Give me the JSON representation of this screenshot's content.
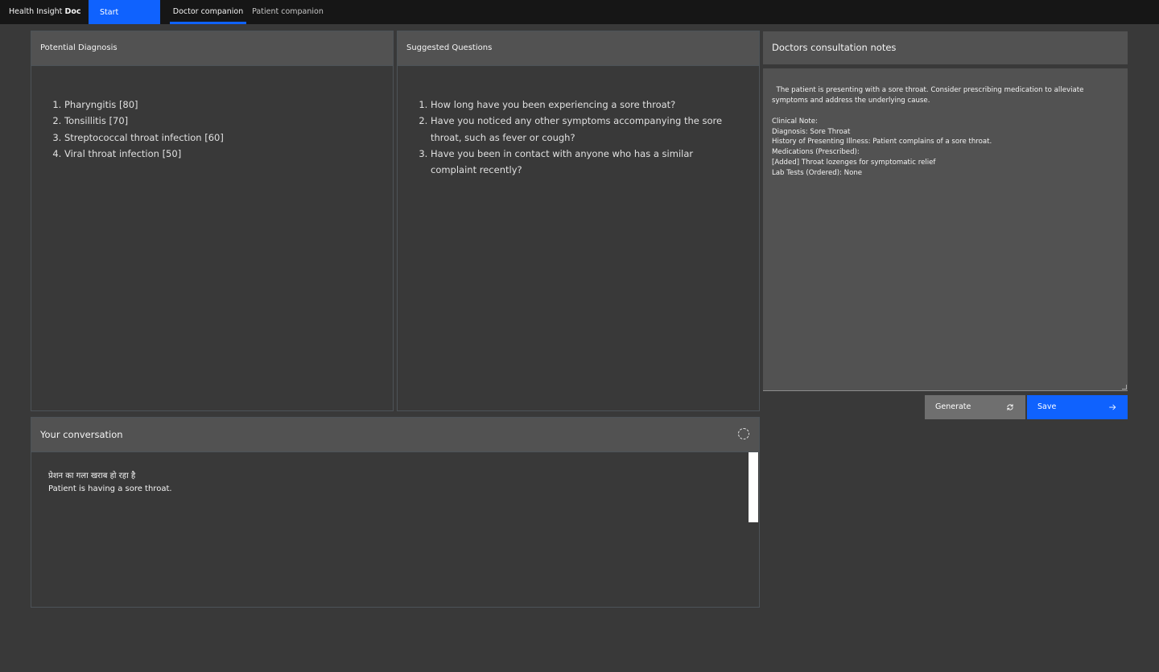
{
  "header": {
    "brand_prefix": "Health Insight",
    "brand_suffix": "Doc",
    "start_label": "Start",
    "tabs": [
      {
        "label": "Doctor companion",
        "active": true
      },
      {
        "label": "Patient companion",
        "active": false
      }
    ]
  },
  "diagnosis": {
    "title": "Potential Diagnosis",
    "items": [
      "Pharyngitis [80]",
      "Tonsillitis [70]",
      "Streptococcal throat infection [60]",
      "Viral throat infection [50]"
    ]
  },
  "questions": {
    "title": "Suggested Questions",
    "items": [
      "How long have you been experiencing a sore throat?",
      "Have you noticed any other symptoms accompanying the sore throat, such as fever or cough?",
      "Have you been in contact with anyone who has a similar complaint recently?"
    ]
  },
  "notes": {
    "title": "Doctors consultation notes",
    "text": "The patient is presenting with a sore throat. Consider prescribing medication to alleviate symptoms and address the underlying cause.\n\nClinical Note:\nDiagnosis: Sore Throat\nHistory of Presenting Illness: Patient complains of a sore throat.\nMedications (Prescribed):\n[Added] Throat lozenges for symptomatic relief\nLab Tests (Ordered): None",
    "generate_label": "Generate",
    "save_label": "Save",
    "generate_icon": "sync-icon",
    "save_icon": "arrow-right-icon"
  },
  "conversation": {
    "title": "Your conversation",
    "original": "प्रेशन का गला खराब हो रहा है",
    "translation": "Patient is having a sore throat."
  },
  "colors": {
    "accent": "#0f62fe",
    "background": "#393939",
    "header_bg": "#161616",
    "panel_head": "#525252"
  }
}
